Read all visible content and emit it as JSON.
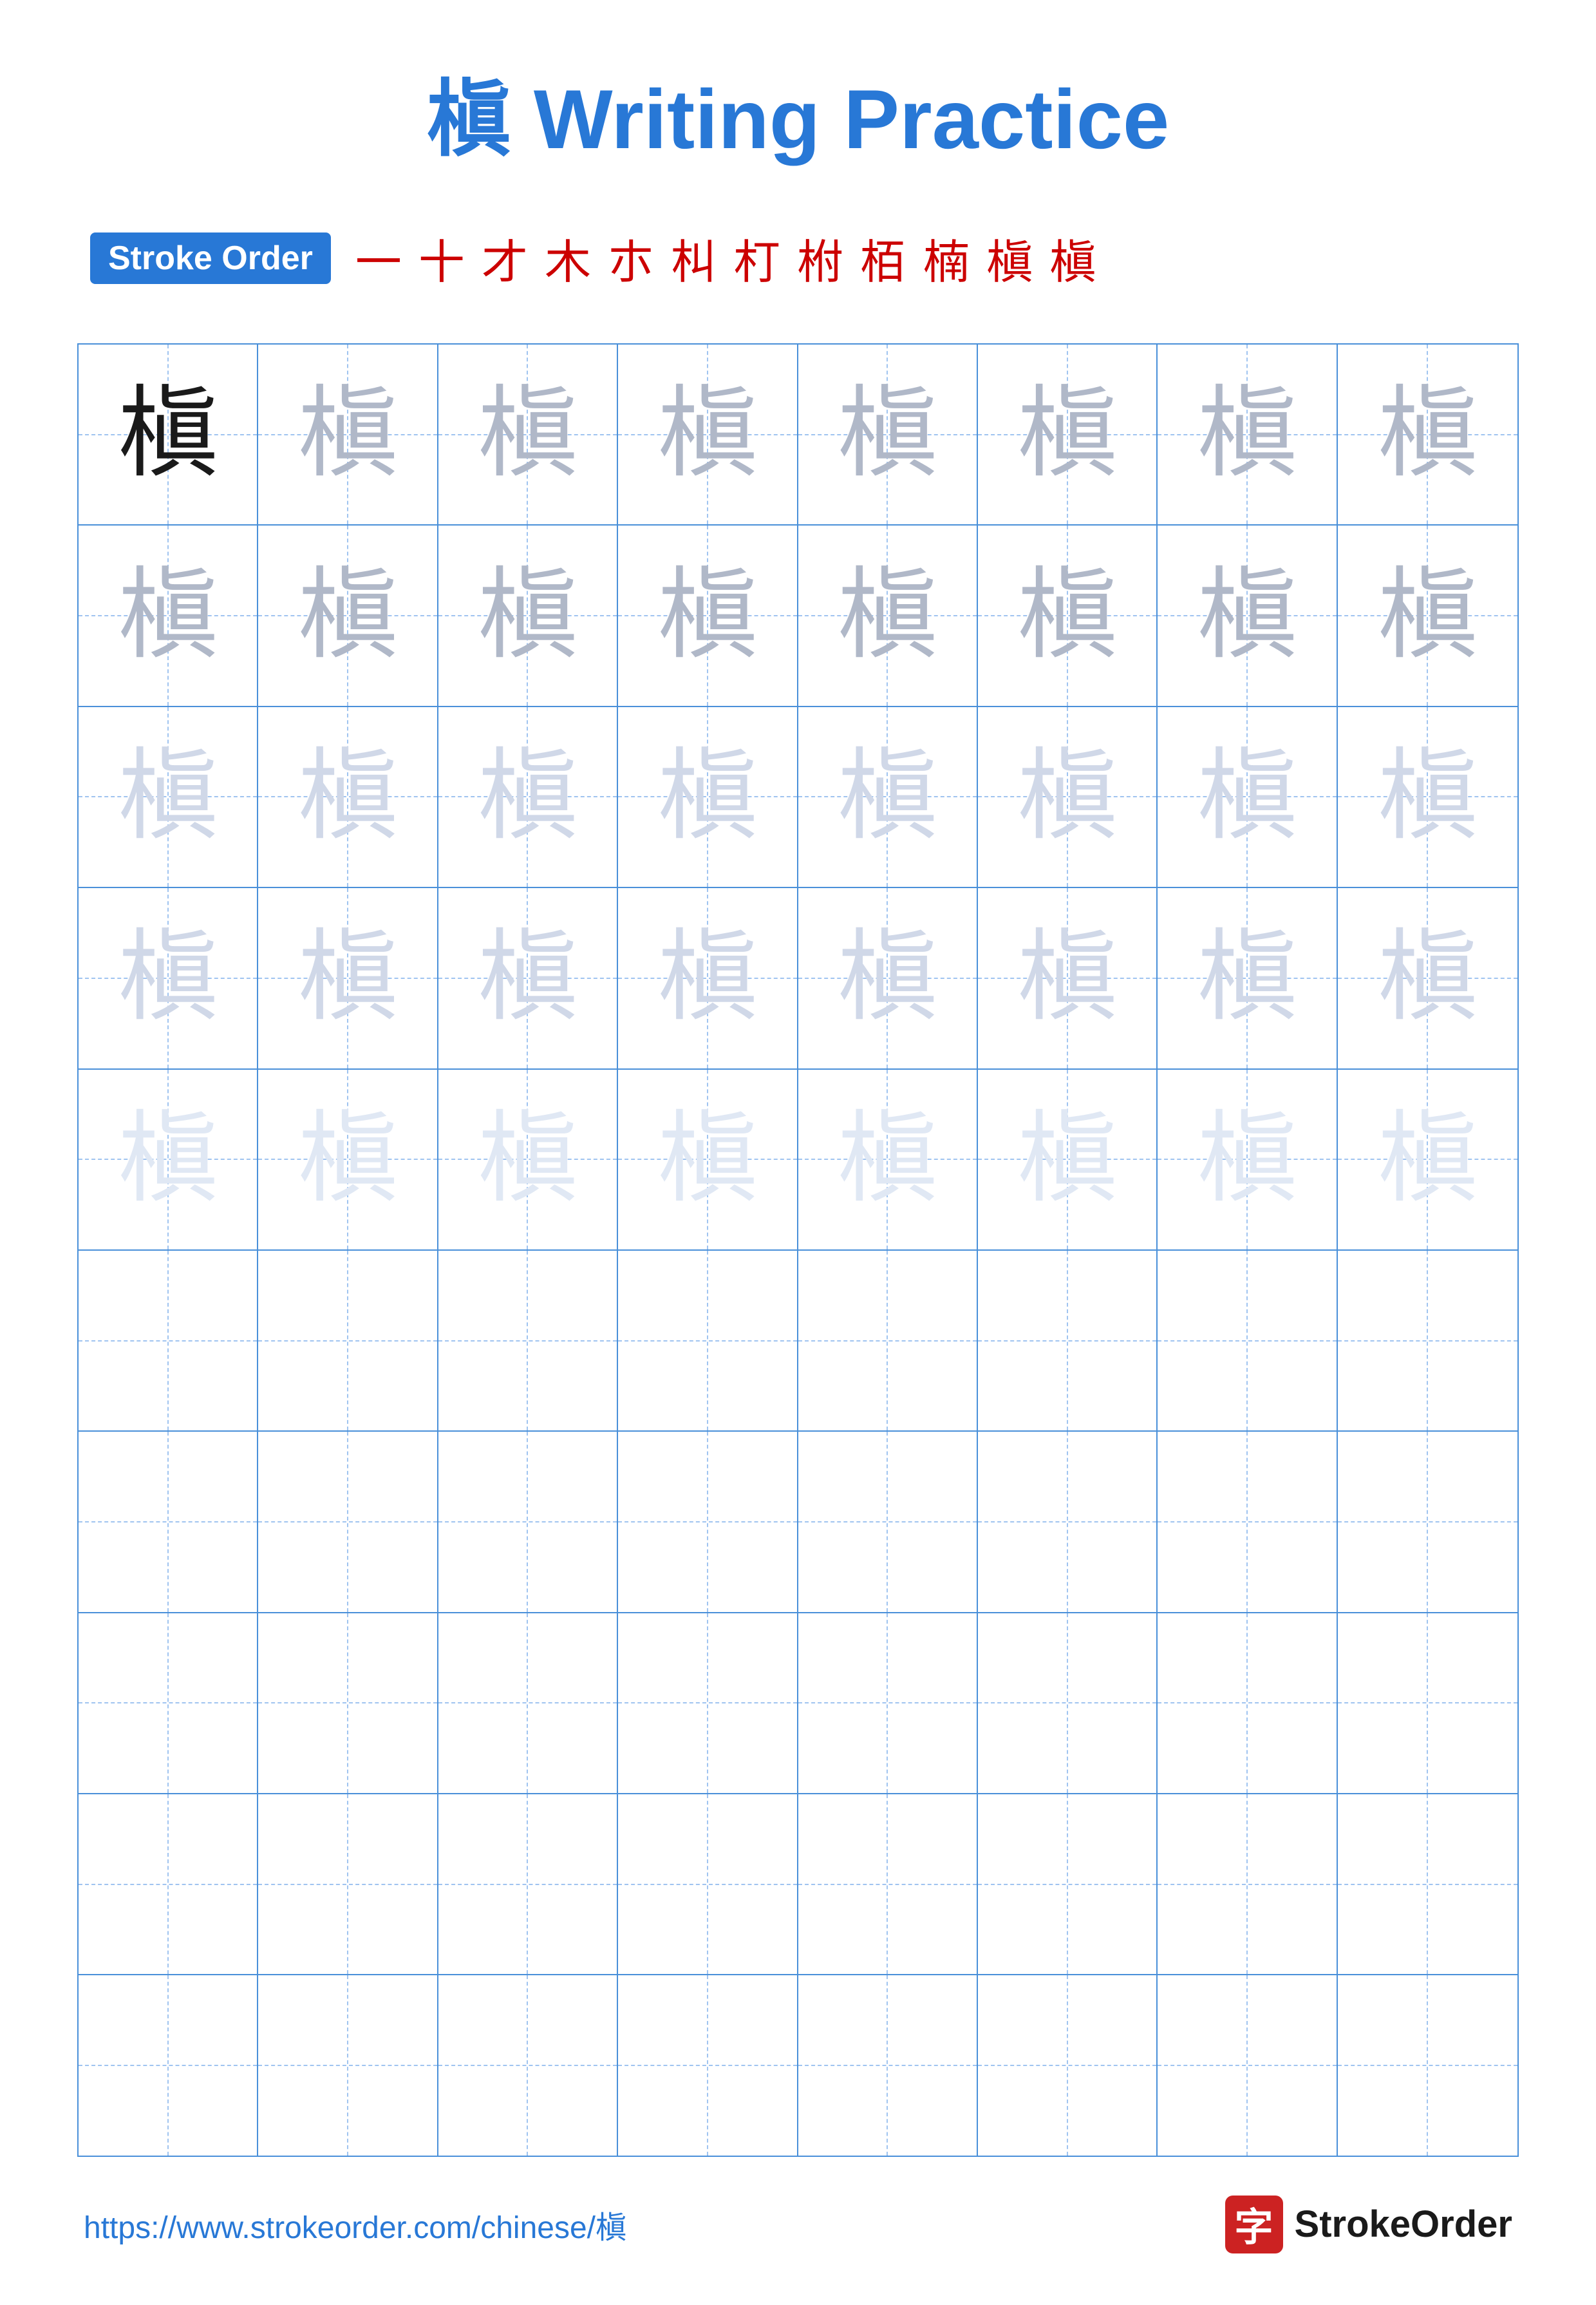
{
  "title": "槇 Writing Practice",
  "stroke_order_badge": "Stroke Order",
  "stroke_sequence": [
    "一",
    "十",
    "才",
    "木",
    "朩",
    "朻",
    "朾",
    "柎",
    "栢",
    "楠",
    "槇",
    "槇"
  ],
  "character": "槇",
  "footer_url": "https://www.strokeorder.com/chinese/槇",
  "footer_logo_char": "字",
  "footer_logo_name": "StrokeOrder",
  "grid": {
    "rows": 10,
    "cols": 8,
    "characters": [
      [
        "dark",
        "medium",
        "medium",
        "medium",
        "medium",
        "medium",
        "medium",
        "medium"
      ],
      [
        "medium",
        "medium",
        "medium",
        "medium",
        "medium",
        "medium",
        "medium",
        "medium"
      ],
      [
        "light",
        "light",
        "light",
        "light",
        "light",
        "light",
        "light",
        "light"
      ],
      [
        "light",
        "light",
        "light",
        "light",
        "light",
        "light",
        "light",
        "light"
      ],
      [
        "very-light",
        "very-light",
        "very-light",
        "very-light",
        "very-light",
        "very-light",
        "very-light",
        "very-light"
      ],
      [
        "empty",
        "empty",
        "empty",
        "empty",
        "empty",
        "empty",
        "empty",
        "empty"
      ],
      [
        "empty",
        "empty",
        "empty",
        "empty",
        "empty",
        "empty",
        "empty",
        "empty"
      ],
      [
        "empty",
        "empty",
        "empty",
        "empty",
        "empty",
        "empty",
        "empty",
        "empty"
      ],
      [
        "empty",
        "empty",
        "empty",
        "empty",
        "empty",
        "empty",
        "empty",
        "empty"
      ],
      [
        "empty",
        "empty",
        "empty",
        "empty",
        "empty",
        "empty",
        "empty",
        "empty"
      ]
    ]
  }
}
